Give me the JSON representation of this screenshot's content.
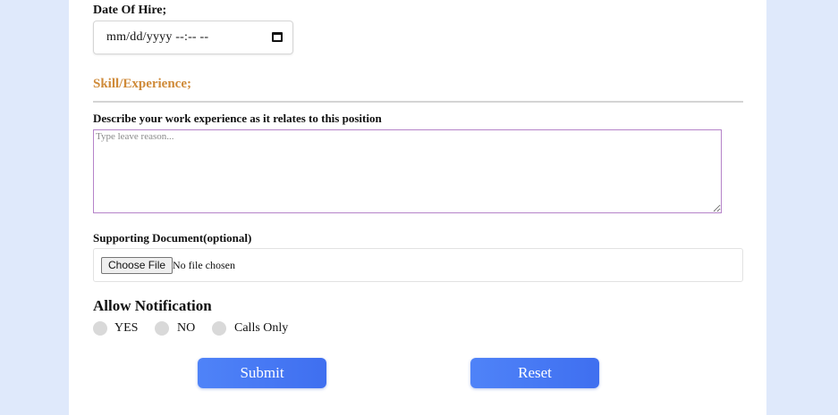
{
  "form": {
    "date_of_hire_label": "Date Of Hire;",
    "date_of_hire_value": "mm/dd/yyyy --:-- --",
    "section_title": "Skill/Experience;",
    "experience_label": "Describe your work experience as it relates to this position",
    "experience_placeholder": "Type leave reason...",
    "supporting_doc_label": "Supporting Document(optional)",
    "choose_file_label": "Choose File",
    "file_status": "No file chosen",
    "notification_title": "Allow Notification",
    "notification_options": [
      "YES",
      "NO",
      "Calls Only"
    ],
    "submit_label": "Submit",
    "reset_label": "Reset"
  },
  "icons": {
    "date_picker": "calendar-icon"
  },
  "colors": {
    "page_background": "#dfe9fb",
    "section_title": "#cf8a38",
    "textarea_border": "#b583c9",
    "button_primary": "#4f83f8",
    "radio_unchecked": "#d9d9d9"
  }
}
